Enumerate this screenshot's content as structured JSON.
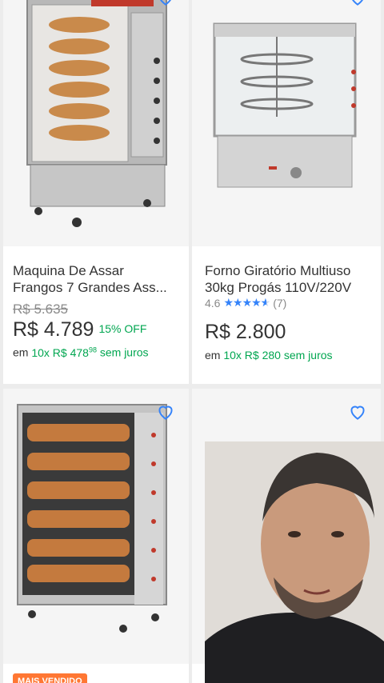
{
  "products": [
    {
      "title_line1": "Maquina De Assar",
      "title_line2": "Frangos 7 Grandes Ass...",
      "old_price": "R$ 5.635",
      "price": "R$ 4.789",
      "discount": "15% OFF",
      "installment_prefix": "em",
      "installment_value": "10x R$ 478",
      "installment_cents": "98",
      "installment_suffix": "sem juros"
    },
    {
      "title_line1": "Forno Giratório Multiuso",
      "title_line2": "30kg Progás 110V/220V",
      "rating_value": "4.6",
      "rating_stars": 4.6,
      "rating_count": "(7)",
      "price": "R$ 2.800",
      "installment_prefix": "em",
      "installment_value": "10x R$ 280",
      "installment_suffix": "sem juros"
    },
    {
      "badge": "MAIS VENDIDO"
    },
    {}
  ],
  "icons": {
    "favorite": "heart-outline-icon",
    "star": "star-icon"
  },
  "colors": {
    "accent_blue": "#3483fa",
    "green": "#00a650",
    "badge_orange": "#ff7733"
  }
}
